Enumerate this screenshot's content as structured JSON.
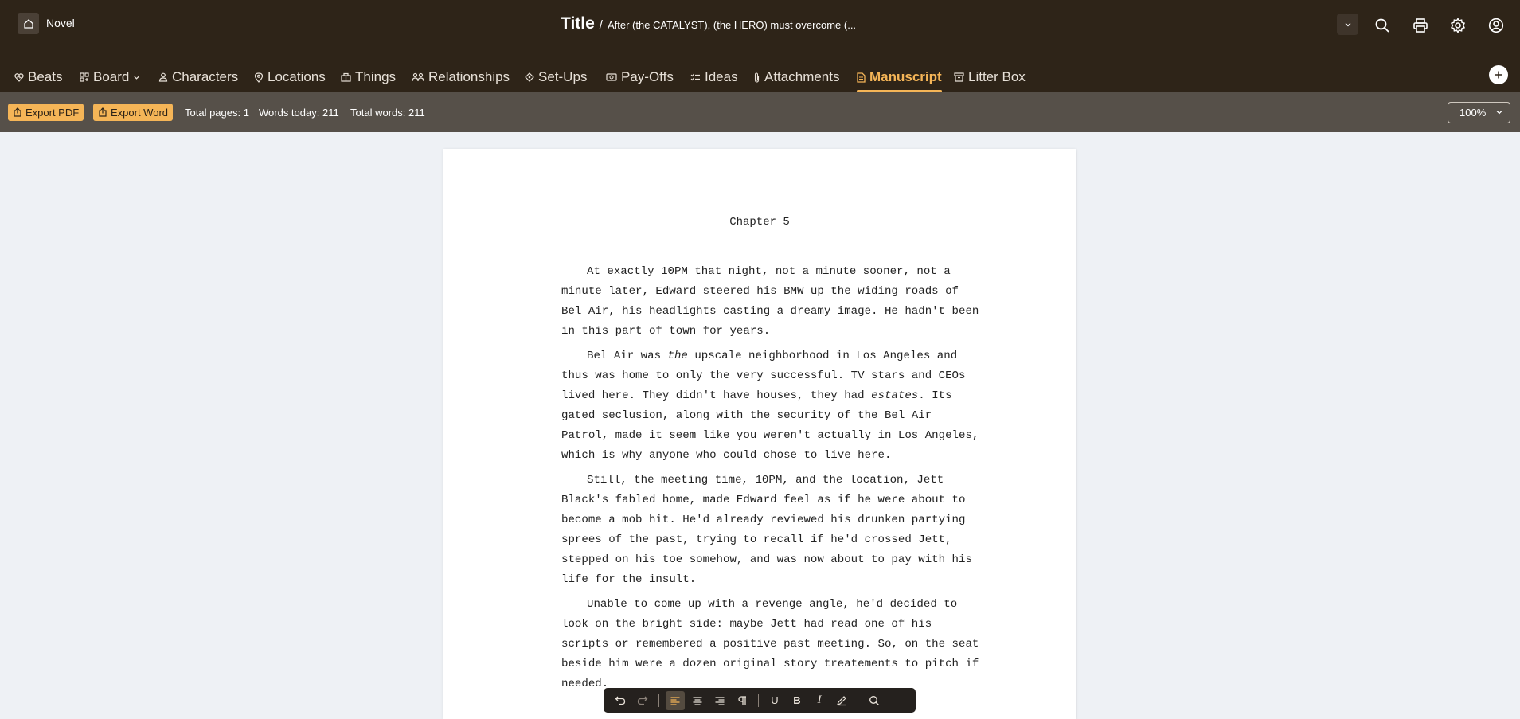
{
  "header": {
    "project_type": "Novel",
    "title": "Title",
    "separator": "/",
    "subtitle": "After (the CATALYST), (the HERO) must overcome (..."
  },
  "nav": {
    "items": [
      {
        "label": "Beats",
        "icon": "beats-icon"
      },
      {
        "label": "Board",
        "icon": "board-icon"
      },
      {
        "label": "Characters",
        "icon": "person-icon"
      },
      {
        "label": "Locations",
        "icon": "location-pin-icon"
      },
      {
        "label": "Things",
        "icon": "things-icon"
      },
      {
        "label": "Relationships",
        "icon": "relationships-icon"
      },
      {
        "label": "Set-Ups",
        "icon": "setup-icon"
      },
      {
        "label": "Pay-Offs",
        "icon": "payoff-icon"
      },
      {
        "label": "Ideas",
        "icon": "ideas-icon"
      },
      {
        "label": "Attachments",
        "icon": "paperclip-icon"
      },
      {
        "label": "Manuscript",
        "icon": "document-icon",
        "active": true
      },
      {
        "label": "Litter Box",
        "icon": "archive-icon"
      }
    ]
  },
  "toolbar": {
    "export_pdf": "Export PDF",
    "export_word": "Export Word",
    "total_pages": "Total pages: 1",
    "words_today": "Words today: 211",
    "total_words": "Total words: 211",
    "zoom": "100%"
  },
  "manuscript": {
    "chapter": "Chapter 5",
    "p1": "At exactly 10PM that night, not a minute sooner, not a minute later, Edward steered his BMW up the widing roads of Bel Air, his headlights casting a dreamy image. He hadn't been in this part of town for years.",
    "p2_a": "Bel Air was ",
    "p2_em1": "the",
    "p2_b": " upscale neighborhood in Los Angeles and thus was home to only the very successful. TV stars and CEOs lived here. They didn't have houses, they had ",
    "p2_em2": "estates",
    "p2_c": ". Its gated seclusion, along with the security of the Bel Air Patrol, made it seem like you weren't actually in Los Angeles, which is why anyone who could chose to live here.",
    "p3": "Still, the meeting time, 10PM, and the location, Jett Black's fabled home, made Edward feel as if he were about to become a mob hit. He'd already reviewed his drunken partying sprees of the past, trying to recall if he'd crossed Jett, stepped on his toe somehow, and was now about to pay with his life for the insult.",
    "p4": "Unable to come up with a revenge angle, he'd decided to look on the bright side: maybe Jett had read one of his scripts or remembered a positive past meeting. So, on the seat beside him were a dozen original story treatements to pitch if needed."
  },
  "editor_toolbar": {
    "bold": "B",
    "italic": "I",
    "underline": "U"
  },
  "colors": {
    "header_bg": "#2e2418",
    "toolbar_bg": "#565049",
    "accent": "#f5b557",
    "canvas_bg": "#eef1f5"
  }
}
